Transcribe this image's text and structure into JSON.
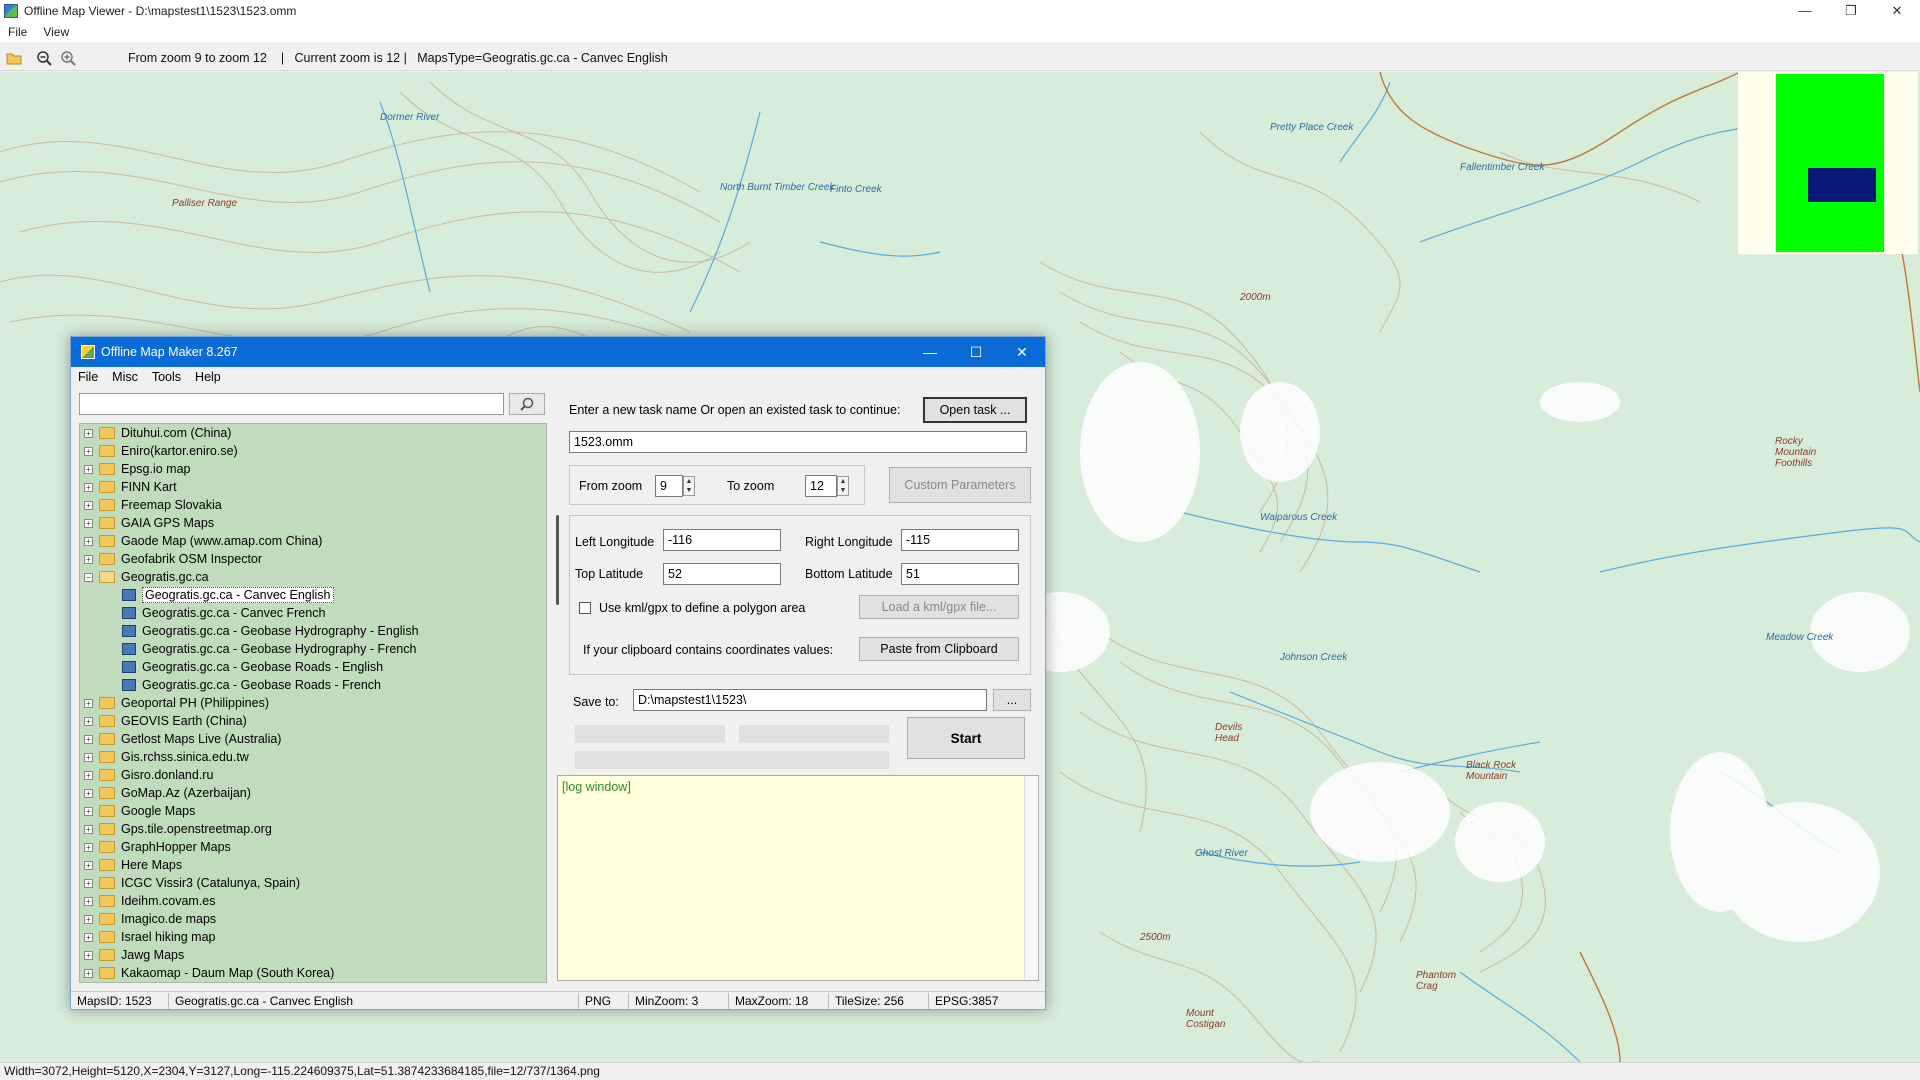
{
  "window": {
    "title": "Offline Map Viewer - D:\\mapstest1\\1523\\1523.omm",
    "controls": [
      "—",
      "❐",
      "✕"
    ]
  },
  "menu": [
    "File",
    "View"
  ],
  "toolbar": {
    "info": "From zoom 9 to zoom 12    |   Current zoom is 12 |   MapsType=Geogratis.gc.ca - Canvec English"
  },
  "map": {
    "labels": [
      "Palliser Range",
      "Dormer River",
      "North Burnt Timber Creek",
      "Finto Creek",
      "Pretty Place Creek",
      "Fallentimber Creek",
      "Rocky Mountain Foothills",
      "Waiparous Creek",
      "Johnson Creek",
      "Devils Head",
      "Black Rock Mountain",
      "Ghost River",
      "Phantom Crag",
      "Mount Costigan",
      "Meadow Creek",
      "2500m",
      "2000m"
    ],
    "minimap_colors": {
      "frame": "#00ff00",
      "view": "#0a1a7a"
    }
  },
  "status_bar": "Width=3072,Height=5120,X=2304,Y=3127,Long=-115.224609375,Lat=51.3874233684185,file=12/737/1364.png",
  "dialog": {
    "title": "Offline Map Maker 8.267",
    "menu": [
      "File",
      "Misc",
      "Tools",
      "Help"
    ],
    "search_value": "",
    "tree": [
      {
        "label": "Dituhui.com (China)",
        "type": "folder"
      },
      {
        "label": "Eniro(kartor.eniro.se)",
        "type": "folder"
      },
      {
        "label": "Epsg.io map",
        "type": "folder"
      },
      {
        "label": "FINN Kart",
        "type": "folder"
      },
      {
        "label": "Freemap Slovakia",
        "type": "folder"
      },
      {
        "label": "GAIA GPS Maps",
        "type": "folder"
      },
      {
        "label": "Gaode Map (www.amap.com China)",
        "type": "folder"
      },
      {
        "label": "Geofabrik OSM Inspector",
        "type": "folder"
      },
      {
        "label": "Geogratis.gc.ca",
        "type": "open"
      },
      {
        "label": "Geogratis.gc.ca - Canvec English",
        "type": "child",
        "selected": true
      },
      {
        "label": "Geogratis.gc.ca - Canvec French",
        "type": "child"
      },
      {
        "label": "Geogratis.gc.ca - Geobase Hydrography - English",
        "type": "child"
      },
      {
        "label": "Geogratis.gc.ca - Geobase Hydrography - French",
        "type": "child"
      },
      {
        "label": "Geogratis.gc.ca - Geobase Roads - English",
        "type": "child"
      },
      {
        "label": "Geogratis.gc.ca - Geobase Roads - French",
        "type": "child"
      },
      {
        "label": "Geoportal PH (Philippines)",
        "type": "folder"
      },
      {
        "label": "GEOVIS Earth (China)",
        "type": "folder"
      },
      {
        "label": "Getlost Maps Live (Australia)",
        "type": "folder"
      },
      {
        "label": "Gis.rchss.sinica.edu.tw",
        "type": "folder"
      },
      {
        "label": "Gisro.donland.ru",
        "type": "folder"
      },
      {
        "label": "GoMap.Az (Azerbaijan)",
        "type": "folder"
      },
      {
        "label": "Google Maps",
        "type": "folder"
      },
      {
        "label": "Gps.tile.openstreetmap.org",
        "type": "folder"
      },
      {
        "label": "GraphHopper Maps",
        "type": "folder"
      },
      {
        "label": "Here Maps",
        "type": "folder"
      },
      {
        "label": "ICGC Vissir3 (Catalunya, Spain)",
        "type": "folder"
      },
      {
        "label": "Ideihm.covam.es",
        "type": "folder"
      },
      {
        "label": "Imagico.de maps",
        "type": "folder"
      },
      {
        "label": "Israel hiking map",
        "type": "folder"
      },
      {
        "label": "Jawg Maps",
        "type": "folder"
      },
      {
        "label": "Kakaomap - Daum Map (South Korea)",
        "type": "folder"
      }
    ],
    "task_prompt": "Enter a new task name Or open an existed task to continue:",
    "open_task": "Open task ...",
    "task_name": "1523.omm",
    "from_zoom_label": "From zoom",
    "from_zoom": "9",
    "to_zoom_label": "To zoom",
    "to_zoom": "12",
    "custom_params": "Custom Parameters",
    "left_lon_label": "Left Longitude",
    "left_lon": "-116",
    "right_lon_label": "Right Longitude",
    "right_lon": "-115",
    "top_lat_label": "Top Latitude",
    "top_lat": "52",
    "bottom_lat_label": "Bottom Latitude",
    "bottom_lat": "51",
    "kml_label": "Use kml/gpx to define a polygon area",
    "load_kml": "Load a kml/gpx file...",
    "clipboard_label": "If your clipboard contains coordinates values:",
    "paste_clipboard": "Paste from Clipboard",
    "save_to_label": "Save to:",
    "save_to": "D:\\mapstest1\\1523\\",
    "browse": "...",
    "start": "Start",
    "log": "[log window]",
    "status": {
      "maps_id": "MapsID: 1523",
      "maps_name": "Geogratis.gc.ca - Canvec English",
      "format": "PNG",
      "min_zoom": "MinZoom: 3",
      "max_zoom": "MaxZoom: 18",
      "tile_size": "TileSize: 256",
      "epsg": "EPSG:3857"
    }
  }
}
